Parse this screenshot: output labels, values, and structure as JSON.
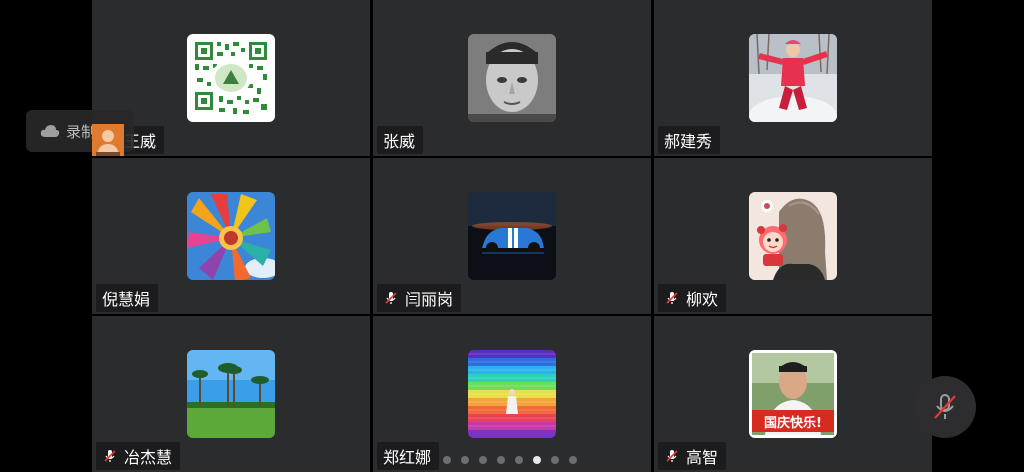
{
  "recording": {
    "label": "录制中",
    "icon": "cloud-icon"
  },
  "pager": {
    "pages": 8,
    "current_page": 6
  },
  "colors": {
    "tile_bg": "#2b2c2e",
    "background": "#000000",
    "self_preview": "#e07a2f"
  },
  "participants": [
    {
      "name": "王威",
      "muted": true,
      "avatar": "qr-code"
    },
    {
      "name": "张威",
      "muted": false,
      "avatar": "man-portrait"
    },
    {
      "name": "郝建秀",
      "muted": false,
      "avatar": "child-in-snow"
    },
    {
      "name": "倪慧娟",
      "muted": false,
      "avatar": "flower"
    },
    {
      "name": "闫丽岗",
      "muted": true,
      "avatar": "blue-car"
    },
    {
      "name": "柳欢",
      "muted": true,
      "avatar": "cartoon-girl"
    },
    {
      "name": "冶杰慧",
      "muted": true,
      "avatar": "palm-trees"
    },
    {
      "name": "郑红娜",
      "muted": false,
      "avatar": "rainbow-stripes"
    },
    {
      "name": "高智",
      "muted": true,
      "avatar": "national-day-portrait",
      "avatar_text": "国庆快乐!"
    }
  ],
  "mute_button": {
    "icon": "mic-off-icon",
    "state": "muted"
  }
}
